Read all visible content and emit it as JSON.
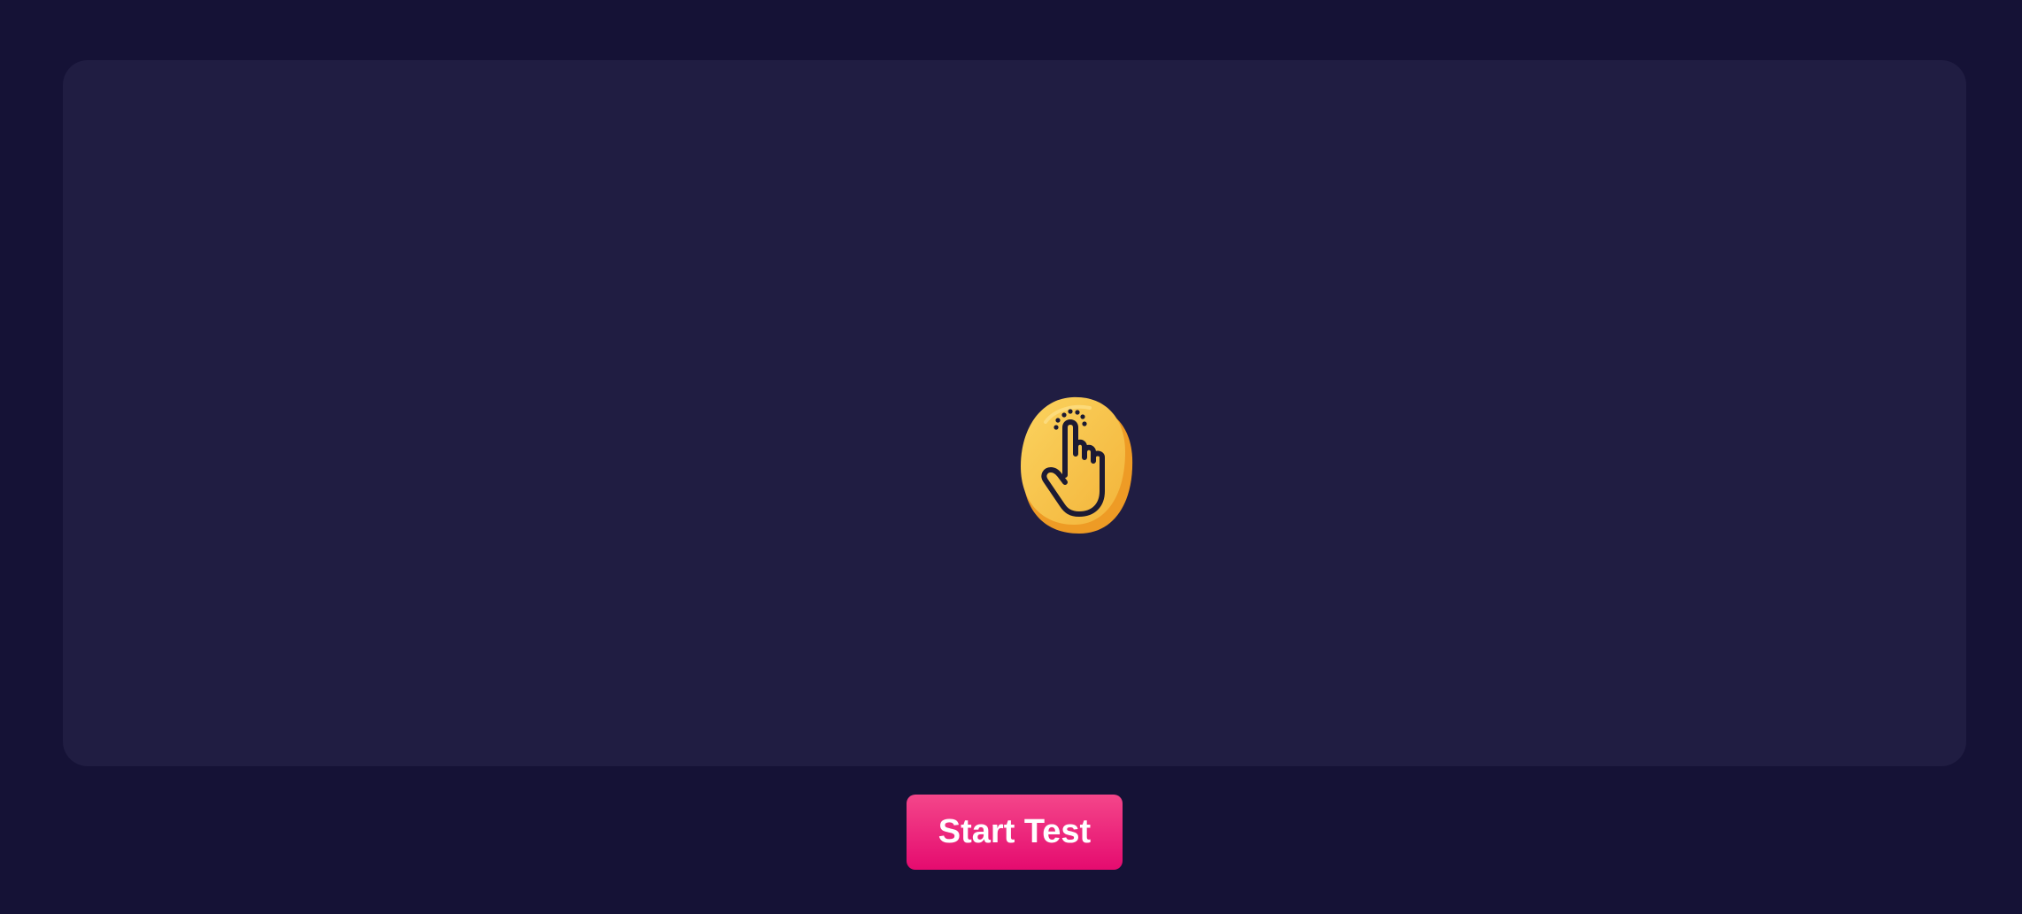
{
  "stage": {
    "icon": "tap-hand-icon",
    "icon_colors": {
      "fill": "#f7c750",
      "edge": "#ee9b25",
      "stroke": "#1c1a33"
    }
  },
  "controls": {
    "start_label": "Start Test"
  },
  "colors": {
    "background": "#151236",
    "panel": "#201d42",
    "button_top": "#f4468a",
    "button_bottom": "#e50b6f",
    "button_text": "#ffffff"
  }
}
